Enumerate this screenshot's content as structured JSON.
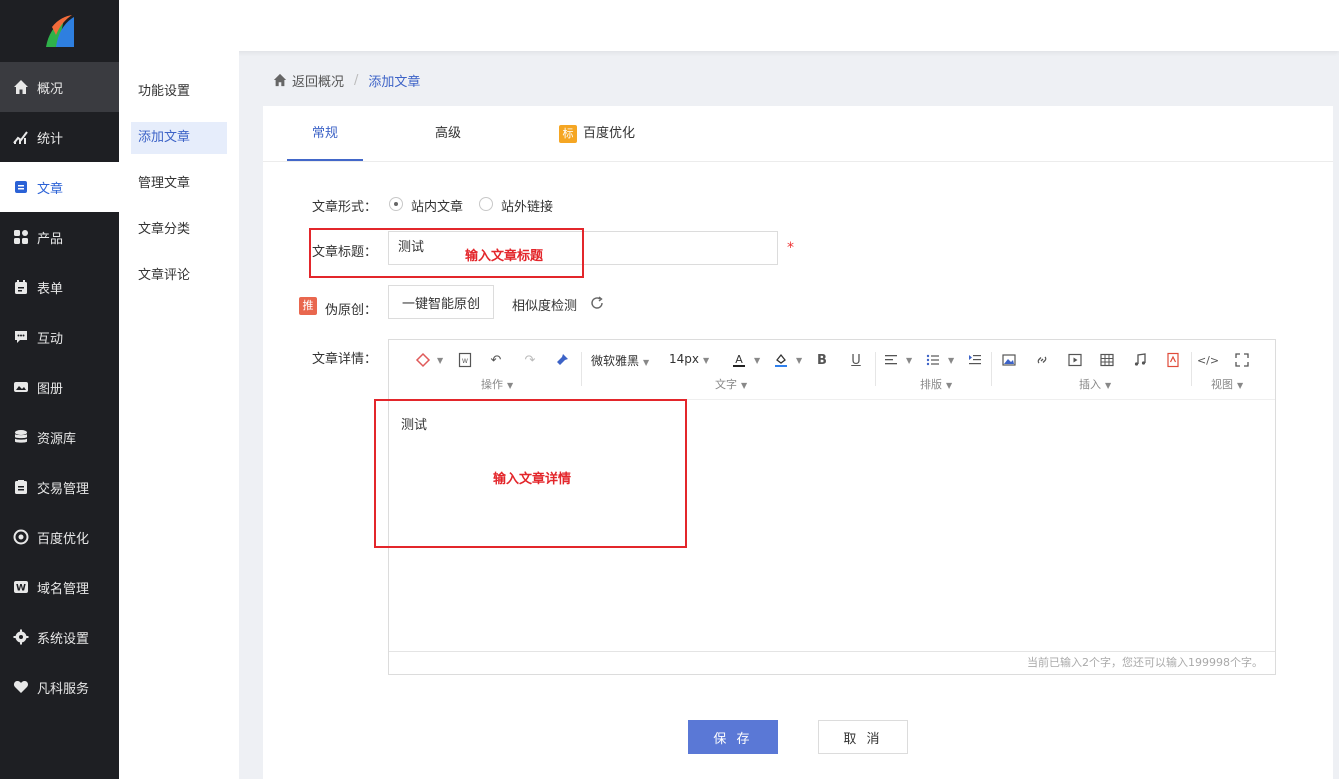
{
  "sidebar": {
    "items": [
      {
        "label": "概况",
        "icon": "home-icon"
      },
      {
        "label": "统计",
        "icon": "chart-icon"
      },
      {
        "label": "文章",
        "icon": "document-icon"
      },
      {
        "label": "产品",
        "icon": "grid-icon"
      },
      {
        "label": "表单",
        "icon": "calendar-icon"
      },
      {
        "label": "互动",
        "icon": "chat-icon"
      },
      {
        "label": "图册",
        "icon": "album-icon"
      },
      {
        "label": "资源库",
        "icon": "database-icon"
      },
      {
        "label": "交易管理",
        "icon": "clipboard-icon"
      },
      {
        "label": "百度优化",
        "icon": "target-icon"
      },
      {
        "label": "域名管理",
        "icon": "domain-icon"
      },
      {
        "label": "系统设置",
        "icon": "gear-icon"
      },
      {
        "label": "凡科服务",
        "icon": "heart-icon"
      }
    ]
  },
  "submenu": {
    "items": [
      "功能设置",
      "添加文章",
      "管理文章",
      "文章分类",
      "文章评论"
    ]
  },
  "breadcrumb": {
    "back": "返回概况",
    "current": "添加文章"
  },
  "tabs": {
    "normal": "常规",
    "advanced": "高级",
    "seo_badge": "标",
    "seo": "百度优化"
  },
  "form": {
    "type_label": "文章形式：",
    "type_internal": "站内文章",
    "type_external": "站外链接",
    "title_label": "文章标题：",
    "title_value": "测试",
    "required_mark": "*",
    "pseudo_badge": "推",
    "pseudo_label": "伪原创：",
    "one_click": "一键智能原创",
    "similarity": "相似度检测",
    "detail_label": "文章详情："
  },
  "editor": {
    "font_family": "微软雅黑",
    "font_size": "14px",
    "bold": "B",
    "underline": "U",
    "group_ops": "操作",
    "group_text": "文字",
    "group_layout": "排版",
    "group_insert": "插入",
    "group_view": "视图",
    "content": "测试",
    "footer": "当前已输入2个字，您还可以输入199998个字。"
  },
  "annotations": {
    "title_hint": "输入文章标题",
    "detail_hint": "输入文章详情"
  },
  "actions": {
    "save": "保 存",
    "cancel": "取 消"
  },
  "colors": {
    "accent": "#4267c9",
    "annotation": "#e3262b",
    "sidebar_bg": "#1e1f23"
  }
}
